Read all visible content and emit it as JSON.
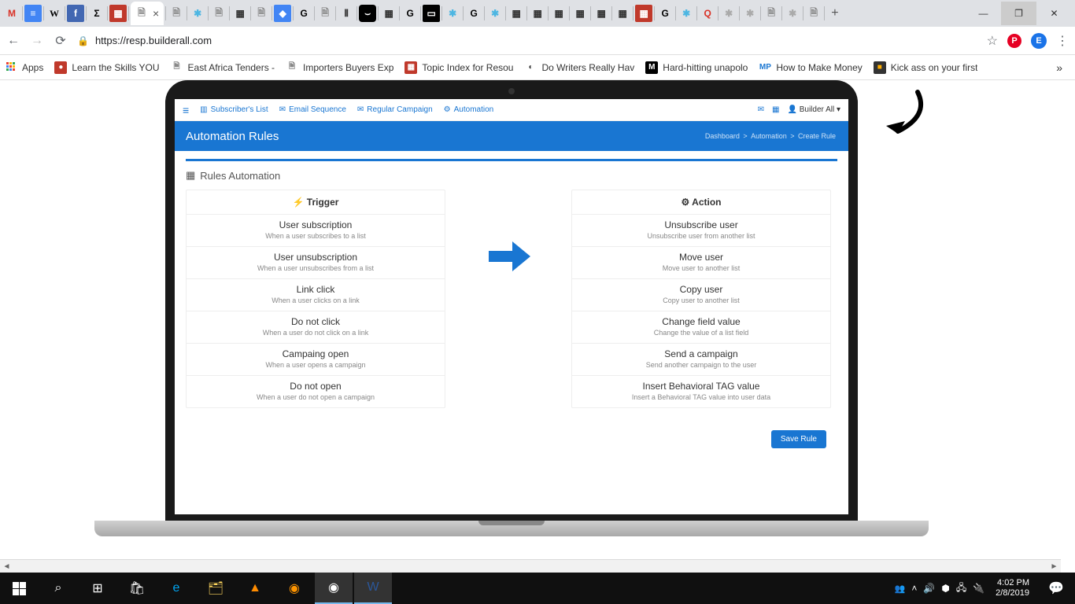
{
  "browser": {
    "url": "https://resp.builderall.com",
    "avatar_letter": "E",
    "apps_label": "Apps",
    "bookmarks": [
      {
        "label": "Learn the Skills YOU",
        "color": "#c0392b",
        "fg": "#fff",
        "letter": "●"
      },
      {
        "label": "East Africa Tenders -",
        "color": "#fff",
        "fg": "#888",
        "letter": "🗎"
      },
      {
        "label": "Importers Buyers Exp",
        "color": "#fff",
        "fg": "#888",
        "letter": "🗎"
      },
      {
        "label": "Topic Index for Resou",
        "color": "#c0392b",
        "fg": "#fff",
        "letter": "▦"
      },
      {
        "label": "Do Writers Really Hav",
        "color": "#fff",
        "fg": "#333",
        "letter": "◐"
      },
      {
        "label": "Hard-hitting unapolo",
        "color": "#000",
        "fg": "#fff",
        "letter": "M"
      },
      {
        "label": "How to Make Money",
        "color": "#fff",
        "fg": "#1976d2",
        "letter": "MP"
      },
      {
        "label": "Kick ass on your first",
        "color": "#333",
        "fg": "#ffae00",
        "letter": "■"
      }
    ]
  },
  "app": {
    "nav": {
      "subscribers": "Subscriber's List",
      "sequence": "Email Sequence",
      "campaign": "Regular Campaign",
      "automation": "Automation"
    },
    "user": "Builder All",
    "page_title": "Automation Rules",
    "breadcrumb": [
      "Dashboard",
      "Automation",
      "Create Rule"
    ],
    "section_title": "Rules Automation",
    "trigger_header": "Trigger",
    "action_header": "Action",
    "triggers": [
      {
        "title": "User subscription",
        "desc": "When a user subscribes to a list"
      },
      {
        "title": "User unsubscription",
        "desc": "When a user unsubscribes from a list"
      },
      {
        "title": "Link click",
        "desc": "When a user clicks on a link"
      },
      {
        "title": "Do not click",
        "desc": "When a user do not click on a link"
      },
      {
        "title": "Campaing open",
        "desc": "When a user opens a campaign"
      },
      {
        "title": "Do not open",
        "desc": "When a user do not open a campaign"
      }
    ],
    "actions": [
      {
        "title": "Unsubscribe user",
        "desc": "Unsubscribe user from another list"
      },
      {
        "title": "Move user",
        "desc": "Move user to another list"
      },
      {
        "title": "Copy user",
        "desc": "Copy user to another list"
      },
      {
        "title": "Change field value",
        "desc": "Change the value of a list field"
      },
      {
        "title": "Send a campaign",
        "desc": "Send another campaign to the user"
      },
      {
        "title": "Insert Behavioral TAG value",
        "desc": "Insert a Behavioral TAG value into user data"
      }
    ],
    "save_label": "Save Rule"
  },
  "taskbar": {
    "time": "4:02 PM",
    "date": "2/8/2019"
  }
}
